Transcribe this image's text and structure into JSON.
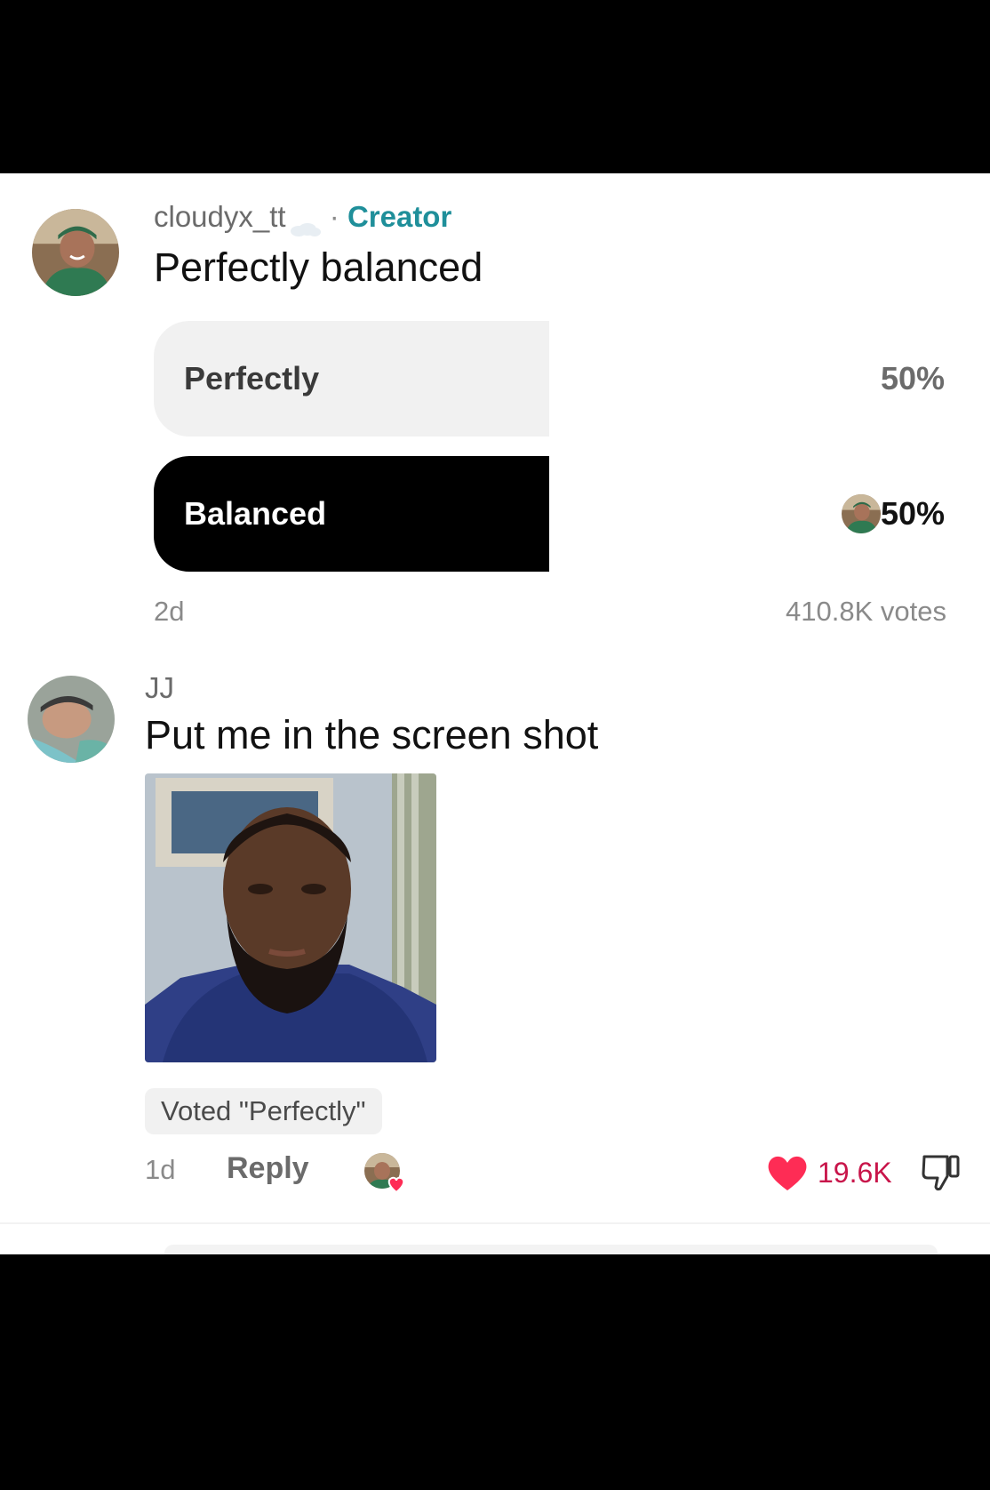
{
  "poll_comment": {
    "username": "cloudyx_tt",
    "separator": "·",
    "badge": "Creator",
    "text": "Perfectly balanced",
    "options": [
      {
        "label": "Perfectly",
        "percent_text": "50%",
        "fill": 0.5,
        "selected": false
      },
      {
        "label": "Balanced",
        "percent_text": "50%",
        "fill": 0.5,
        "selected": true
      }
    ],
    "age": "2d",
    "votes": "410.8K votes"
  },
  "reply_comment": {
    "username": "JJ",
    "text": "Put me in the screen shot",
    "voted_chip": "Voted \"Perfectly\"",
    "age": "1d",
    "reply_label": "Reply",
    "likes": "19.6K"
  },
  "colors": {
    "creator_badge": "#1f8f9a",
    "like": "#fe2c55",
    "selected_bar": "#000000",
    "unselected_bar": "#f1f1f1"
  },
  "icons": {
    "cloud": "cloud-icon",
    "heart": "heart-icon",
    "dislike": "thumbs-down-icon",
    "creator_liked": "creator-liked-icon"
  }
}
